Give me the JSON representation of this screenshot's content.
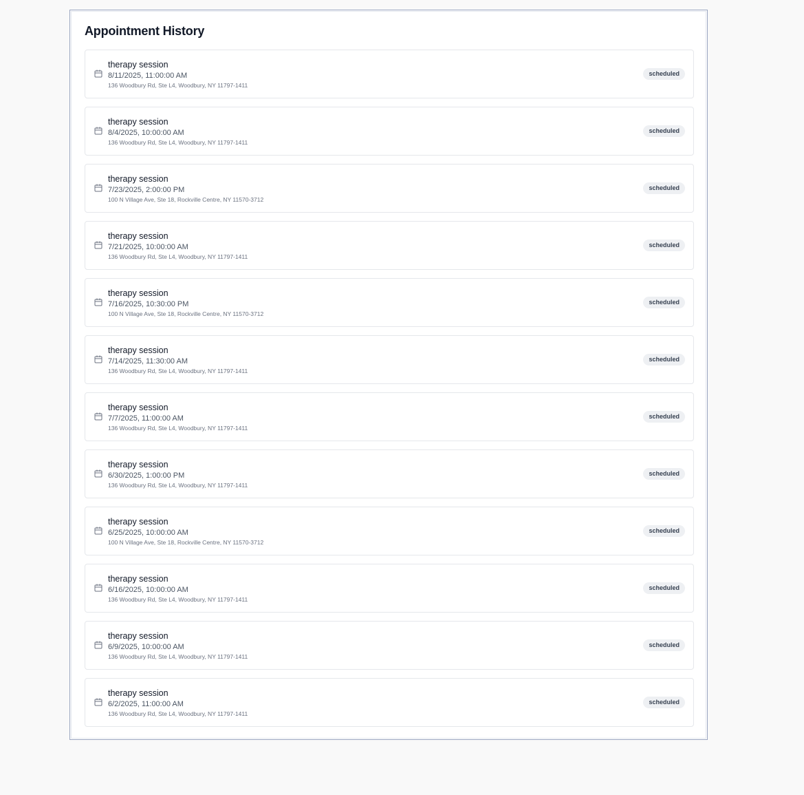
{
  "page": {
    "title": "Appointment History"
  },
  "appointments": [
    {
      "title": "therapy session",
      "datetime": "8/11/2025, 11:00:00 AM",
      "address": "136 Woodbury Rd, Ste L4, Woodbury, NY 11797-1411",
      "status": "scheduled"
    },
    {
      "title": "therapy session",
      "datetime": "8/4/2025, 10:00:00 AM",
      "address": "136 Woodbury Rd, Ste L4, Woodbury, NY 11797-1411",
      "status": "scheduled"
    },
    {
      "title": "therapy session",
      "datetime": "7/23/2025, 2:00:00 PM",
      "address": "100 N Village Ave, Ste 18, Rockville Centre, NY 11570-3712",
      "status": "scheduled"
    },
    {
      "title": "therapy session",
      "datetime": "7/21/2025, 10:00:00 AM",
      "address": "136 Woodbury Rd, Ste L4, Woodbury, NY 11797-1411",
      "status": "scheduled"
    },
    {
      "title": "therapy session",
      "datetime": "7/16/2025, 10:30:00 PM",
      "address": "100 N Village Ave, Ste 18, Rockville Centre, NY 11570-3712",
      "status": "scheduled"
    },
    {
      "title": "therapy session",
      "datetime": "7/14/2025, 11:30:00 AM",
      "address": "136 Woodbury Rd, Ste L4, Woodbury, NY 11797-1411",
      "status": "scheduled"
    },
    {
      "title": "therapy session",
      "datetime": "7/7/2025, 11:00:00 AM",
      "address": "136 Woodbury Rd, Ste L4, Woodbury, NY 11797-1411",
      "status": "scheduled"
    },
    {
      "title": "therapy session",
      "datetime": "6/30/2025, 1:00:00 PM",
      "address": "136 Woodbury Rd, Ste L4, Woodbury, NY 11797-1411",
      "status": "scheduled"
    },
    {
      "title": "therapy session",
      "datetime": "6/25/2025, 10:00:00 AM",
      "address": "100 N Village Ave, Ste 18, Rockville Centre, NY 11570-3712",
      "status": "scheduled"
    },
    {
      "title": "therapy session",
      "datetime": "6/16/2025, 10:00:00 AM",
      "address": "136 Woodbury Rd, Ste L4, Woodbury, NY 11797-1411",
      "status": "scheduled"
    },
    {
      "title": "therapy session",
      "datetime": "6/9/2025, 10:00:00 AM",
      "address": "136 Woodbury Rd, Ste L4, Woodbury, NY 11797-1411",
      "status": "scheduled"
    },
    {
      "title": "therapy session",
      "datetime": "6/2/2025, 11:00:00 AM",
      "address": "136 Woodbury Rd, Ste L4, Woodbury, NY 11797-1411",
      "status": "scheduled"
    }
  ],
  "icons": {
    "appointment": "calendar-icon"
  },
  "colors": {
    "panel_border": "#9aa5c0",
    "badge_bg": "#eef0f3",
    "card_border": "#e5e7eb"
  }
}
